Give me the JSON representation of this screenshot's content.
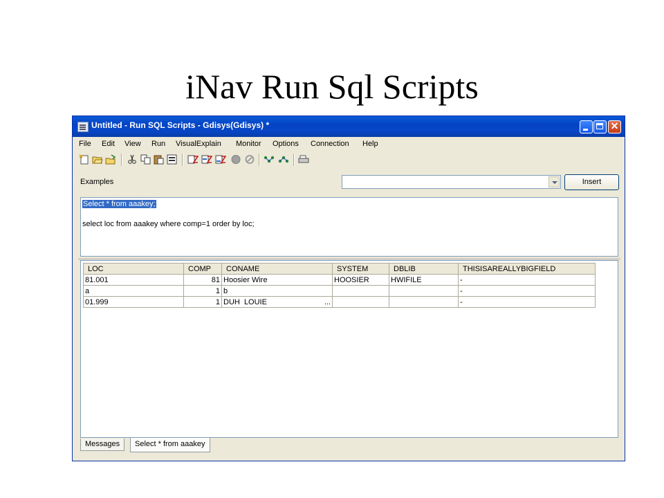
{
  "slide": {
    "title": "iNav Run Sql Scripts"
  },
  "window": {
    "title": "Untitled - Run SQL Scripts - Gdisys(Gdisys) *"
  },
  "menu": [
    "File",
    "Edit",
    "View",
    "Run",
    "VisualExplain",
    "Monitor",
    "Options",
    "Connection",
    "Help"
  ],
  "toolbar": {
    "icons": [
      "new-icon",
      "open-icon",
      "save-icon",
      "cut-icon",
      "copy-icon",
      "paste-icon",
      "select-all-icon",
      "run-all-icon",
      "run-from-selected-icon",
      "run-selected-icon",
      "stop-icon",
      "cancel-icon",
      "explain-icon",
      "run-and-explain-icon",
      "print-icon"
    ]
  },
  "examples": {
    "label": "Examples",
    "value": "",
    "insert_label": "Insert"
  },
  "editor": {
    "lines": [
      "Select * from aaakey;",
      "select loc from aaakey where comp=1 order by loc;"
    ]
  },
  "results": {
    "columns": [
      "LOC",
      "COMP",
      "CONAME",
      "SYSTEM",
      "DBLIB",
      "THISISAREALLYBIGFIELD"
    ],
    "rows": [
      [
        "81.001",
        "81",
        "Hoosier Wire",
        "HOOSIER",
        "HWIFILE",
        "-"
      ],
      [
        "a",
        "1",
        "b",
        "",
        "",
        "-"
      ],
      [
        "01.999",
        "1",
        "DUH  LOUIE",
        "",
        "",
        "-"
      ]
    ],
    "ellipsis": "..."
  },
  "tabs": [
    "Messages",
    "Select * from aaakey"
  ],
  "colors": {
    "titlebar": "#0a5ad8",
    "selection": "#316ac5",
    "window_bg": "#ece9d8"
  }
}
